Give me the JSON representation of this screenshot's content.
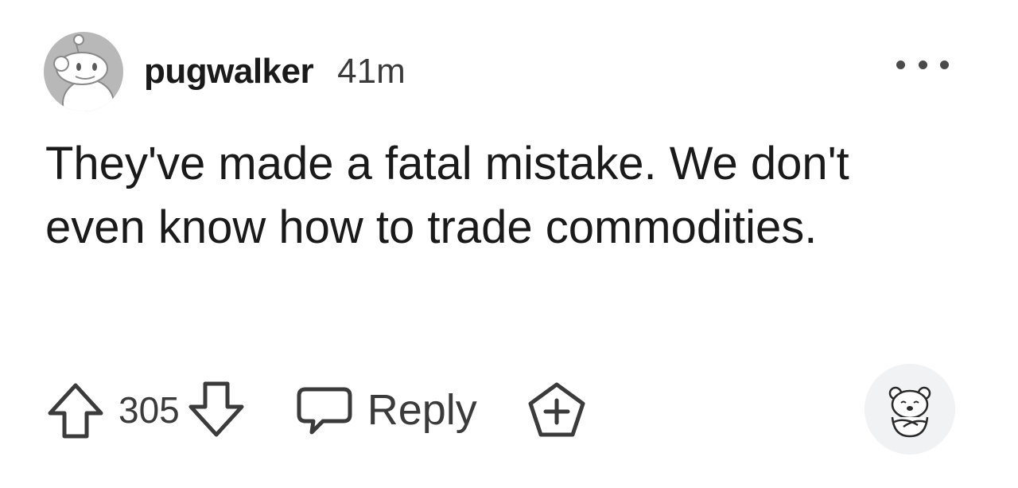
{
  "comment": {
    "username": "pugwalker",
    "timestamp": "41m",
    "body": "They've made a fatal mistake. We don't even know how to trade commodities.",
    "score": "305",
    "reply_label": "Reply"
  },
  "icons": {
    "avatar": "snoo-avatar",
    "more": "more-options-icon",
    "upvote": "upvote-arrow-icon",
    "downvote": "downvote-arrow-icon",
    "reply": "speech-bubble-icon",
    "award": "award-plus-icon",
    "reaction": "polar-bear-icon"
  },
  "colors": {
    "text": "#1a1a1b",
    "muted": "#3b3b3b",
    "avatar_bg": "#b8b8b8",
    "reaction_bg": "#f1f2f3"
  }
}
